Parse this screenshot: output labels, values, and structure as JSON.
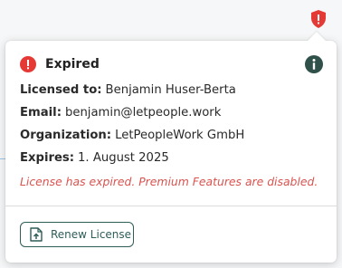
{
  "license": {
    "status_title": "Expired",
    "fields": [
      {
        "label": "Licensed to:",
        "value": "Benjamin Huser-Berta"
      },
      {
        "label": "Email:",
        "value": "benjamin@letpeople.work"
      },
      {
        "label": "Organization:",
        "value": "LetPeopleWork GmbH"
      },
      {
        "label": "Expires:",
        "value": "1. August 2025"
      }
    ],
    "warning": "License has expired. Premium Features are disabled.",
    "renew_label": "Renew License"
  },
  "icons": {
    "toolbar": "shield-alert-icon",
    "status": "error-circle-icon",
    "info": "info-icon",
    "renew": "file-upload-icon"
  },
  "colors": {
    "error": "#e53935",
    "warning_text": "#d9534f",
    "info_bg": "#2f5149",
    "button_accent": "#2f5d58"
  }
}
